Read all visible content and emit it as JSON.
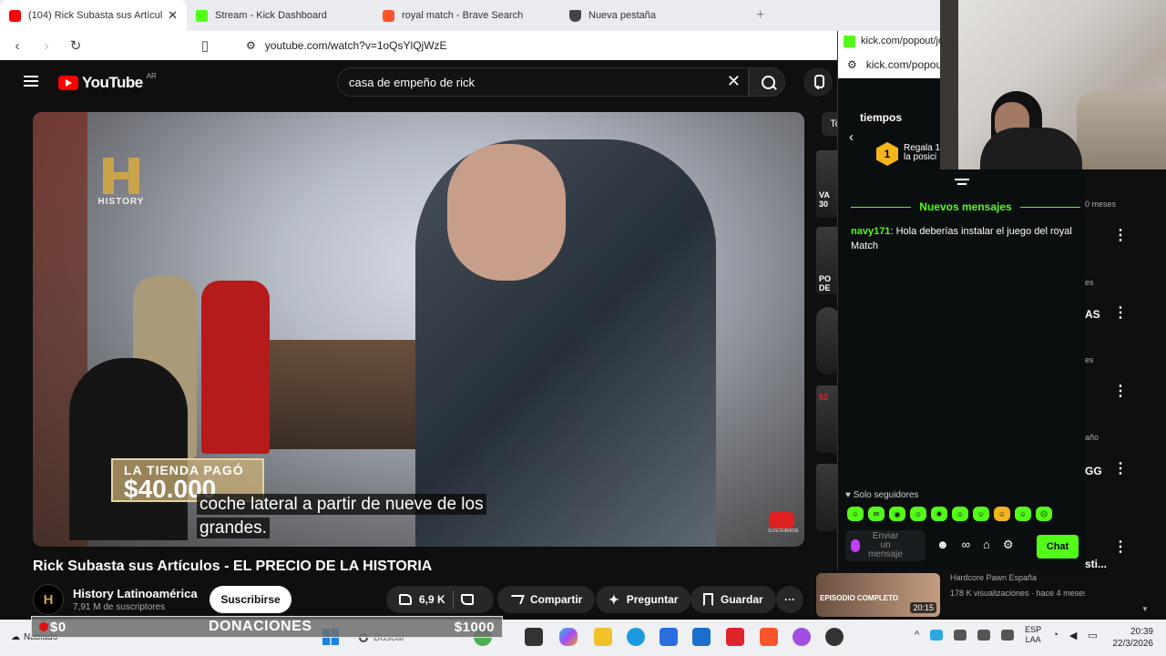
{
  "browser": {
    "tabs": [
      {
        "label": "(104) Rick Subasta sus Artícul",
        "icon": "youtube-icon",
        "active": true
      },
      {
        "label": "Stream - Kick Dashboard",
        "icon": "kick-icon"
      },
      {
        "label": "royal match - Brave Search",
        "icon": "brave-icon"
      },
      {
        "label": "Nueva pestaña",
        "icon": "shield-icon"
      }
    ],
    "close_glyph": "✕",
    "new_tab_glyph": "+",
    "url": "youtube.com/watch?v=1oQsYlQjWzE"
  },
  "youtube": {
    "logo_text": "YouTube",
    "country": "AR",
    "search_query": "casa de empeño de rick",
    "clear_glyph": "✕",
    "player": {
      "watermark": "HISTORY",
      "price_line1": "LA TIENDA PAGÓ",
      "price_line2": "$40.000",
      "subtitle_line1": "coche lateral a partir de nueve de los",
      "subtitle_line2": "grandes.",
      "subscribe_watermark": "SUSCRIBIRSE"
    },
    "video_title": "Rick Subasta sus Artículos - EL PRECIO DE LA HISTORIA",
    "channel": {
      "name": "History Latinoamérica",
      "subscribers": "7,91 M de suscriptores",
      "avatar_letter": "H"
    },
    "subscribe_label": "Suscribirse",
    "likes": "6,9 K",
    "share_label": "Compartir",
    "ask_label": "Preguntar",
    "save_label": "Guardar",
    "more_glyph": "···",
    "recs": {
      "chip": "To",
      "thumb1_text": "VA 30",
      "meta1": "0 meses",
      "thumb2_text": "PO DE",
      "meta2": "es",
      "title3": "AS",
      "meta3": "es",
      "thumb4_text": "$2",
      "meta4": "año",
      "title5": "GG",
      "title6": "sti...",
      "big_ep_label": "EPISODIO COMPLETO",
      "big_duration": "20:15",
      "big_channel": "Hardcore Pawn España",
      "big_views": "178 K visualizaciones · hace 4 meses"
    }
  },
  "kick": {
    "popout_url_1": "kick.com/popout/joa",
    "popout_url_2": "kick.com/popou",
    "header_label": "tiempos",
    "rank": "1",
    "regala_line1": "Regala 1",
    "regala_line2": "la posici",
    "new_messages": "Nuevos mensajes",
    "messages": [
      {
        "user": "navy171",
        "text": "Hola deberías instalar el juego del royal Match"
      }
    ],
    "followers_only": "Solo seguidores",
    "input_placeholder": "Enviar un mensaje",
    "chat_button": "Chat",
    "accent": "#53fc18"
  },
  "taskbar": {
    "weather": "Nublado",
    "search_placeholder": "Buscar",
    "lang1": "ESP",
    "lang2": "LAA",
    "time": "20:39",
    "date": "22/3/2026"
  },
  "overlay": {
    "left": "$0",
    "center": "DONACIONES",
    "right": "$1000"
  }
}
